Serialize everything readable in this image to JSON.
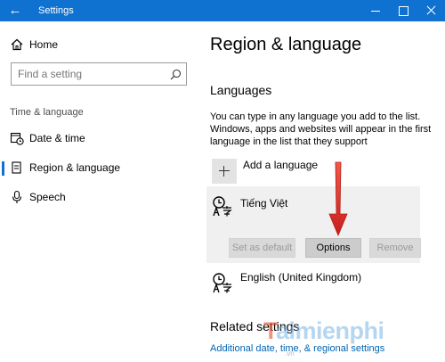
{
  "window": {
    "title": "Settings",
    "back_glyph": "←",
    "titlebar_color": "#0f72d0",
    "controls": [
      "minimize-icon",
      "maximize-icon",
      "close-icon"
    ]
  },
  "sidebar": {
    "home_label": "Home",
    "search_placeholder": "Find a setting",
    "section_label": "Time & language",
    "items": [
      {
        "label": "Date & time",
        "icon": "calendar-clock-icon",
        "selected": false
      },
      {
        "label": "Region & language",
        "icon": "region-language-icon",
        "selected": true
      },
      {
        "label": "Speech",
        "icon": "microphone-icon",
        "selected": false
      }
    ],
    "accent": "#0f72d0"
  },
  "main": {
    "page_title": "Region & language",
    "languages_heading": "Languages",
    "description": "You can type in any language you add to the list. Windows, apps and websites will appear in the first language in the list that they support",
    "add_language_label": "Add a language",
    "languages": [
      {
        "name": "Tiếng Việt",
        "icon": "language-icon",
        "buttons": {
          "set_default": "Set as default",
          "options": "Options",
          "remove": "Remove"
        }
      },
      {
        "name": "English (United Kingdom)",
        "icon": "language-icon"
      }
    ],
    "related_heading": "Related settings",
    "related_link": "Additional date, time, & regional settings"
  },
  "annotation": {
    "arrow_color": "#e0312b"
  },
  "watermark": {
    "text_prefix": "T",
    "text_rest": "aimienphi",
    "sub": ".vn"
  }
}
